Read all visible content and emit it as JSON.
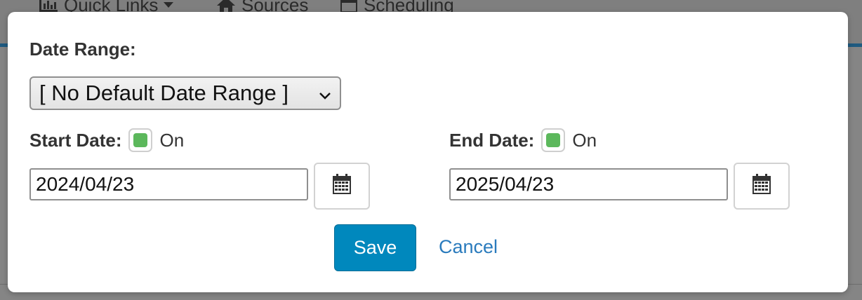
{
  "background_nav": {
    "items": [
      {
        "label": "Quick Links",
        "icon": "bar-chart-icon",
        "has_dropdown": true
      },
      {
        "label": "Sources",
        "icon": "home-icon"
      },
      {
        "label": "Scheduling",
        "icon": "calendar-icon"
      }
    ]
  },
  "modal": {
    "date_range": {
      "label": "Date Range:",
      "selected": "[ No Default Date Range ]"
    },
    "start_date": {
      "label": "Start Date:",
      "toggle_text": "On",
      "value": "2024/04/23"
    },
    "end_date": {
      "label": "End Date:",
      "toggle_text": "On",
      "value": "2025/04/23"
    },
    "save_label": "Save",
    "cancel_label": "Cancel"
  },
  "colors": {
    "accent": "#0088bd",
    "link": "#2a7bbd",
    "toggle_on": "#5cb85c"
  }
}
